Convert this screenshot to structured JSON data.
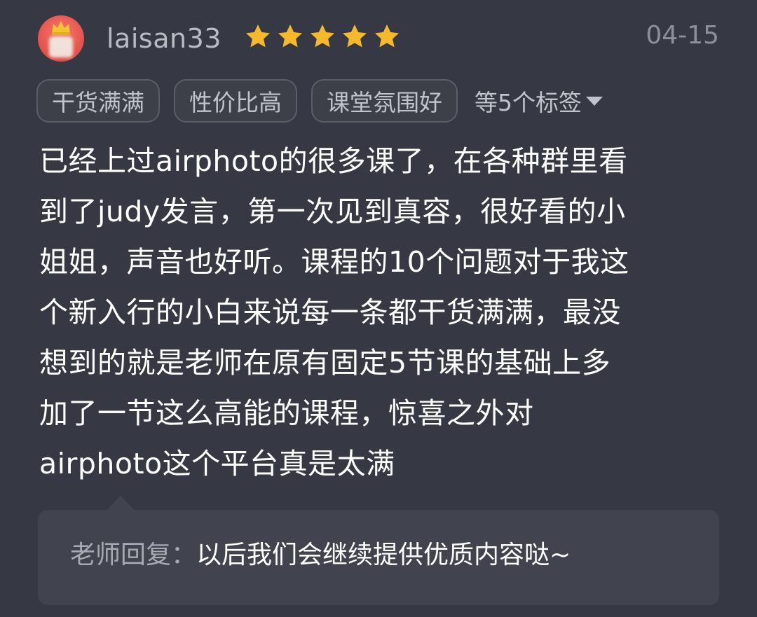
{
  "review": {
    "username": "laisan33",
    "rating": {
      "value": 5,
      "max": 5,
      "color": "#f6b92b"
    },
    "date": "04-15",
    "avatar": {
      "bg_color": "#e6564e",
      "crown_color": "#f4c430"
    },
    "tags": [
      "干货满满",
      "性价比高",
      "课堂氛围好"
    ],
    "more_tags": "等5个标签",
    "body_lines": [
      "已经上过airphoto的很多课了，在各种群里看",
      "到了judy发言，第一次见到真容，很好看的小",
      "姐姐，声音也好听。课程的10个问题对于我这",
      "个新入行的小白来说每一条都干货满满，最没",
      "想到的就是老师在原有固定5节课的基础上多",
      "加了一节这么高能的课程，惊喜之外对",
      "airphoto这个平台真是太满"
    ],
    "reply": {
      "label": "老师回复：",
      "text": "以后我们会继续提供优质内容哒~"
    }
  }
}
